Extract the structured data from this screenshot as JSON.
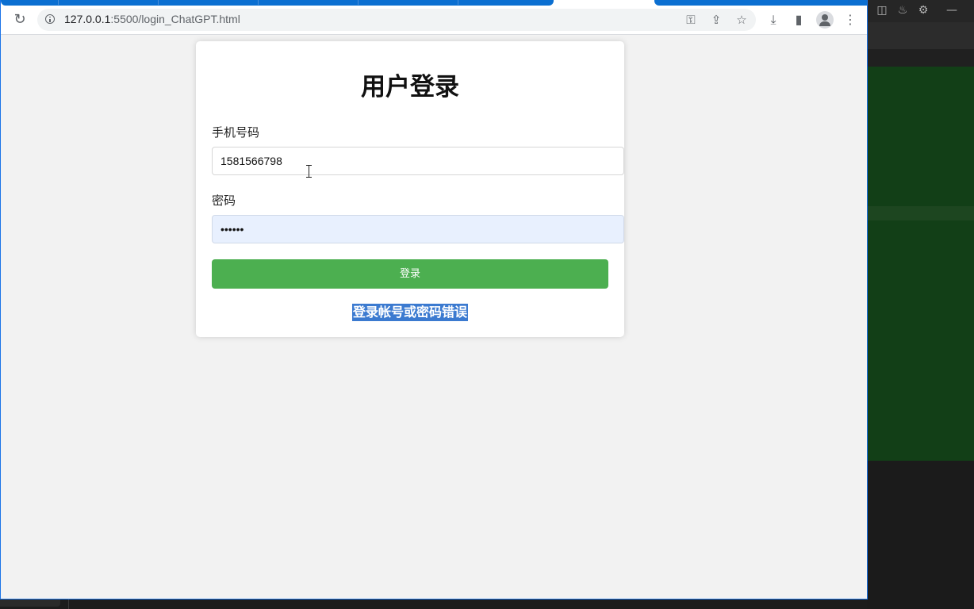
{
  "browser": {
    "url_host": "127.0.0.1",
    "url_rest": ":5500/login_ChatGPT.html",
    "icons": {
      "reload": "↻",
      "key": "⚿",
      "share": "⇪",
      "star": "☆",
      "download": "⤓",
      "side_panel": "▮",
      "menu": "⋮"
    }
  },
  "login": {
    "title": "用户登录",
    "phone_label": "手机号码",
    "phone_value": "1581566798",
    "password_label": "密码",
    "password_value": "••••••",
    "submit_label": "登录",
    "error_message": "登录帐号或密码错误"
  },
  "background_app": {
    "icons": {
      "layout": "◫",
      "flame": "♨",
      "settings": "⚙",
      "minimize": "—"
    }
  },
  "colors": {
    "accent_blue": "#1a73e8",
    "button_green": "#4caf50",
    "autofill_bg": "#e8f0fe",
    "selection_blue": "#3b7ad0"
  }
}
